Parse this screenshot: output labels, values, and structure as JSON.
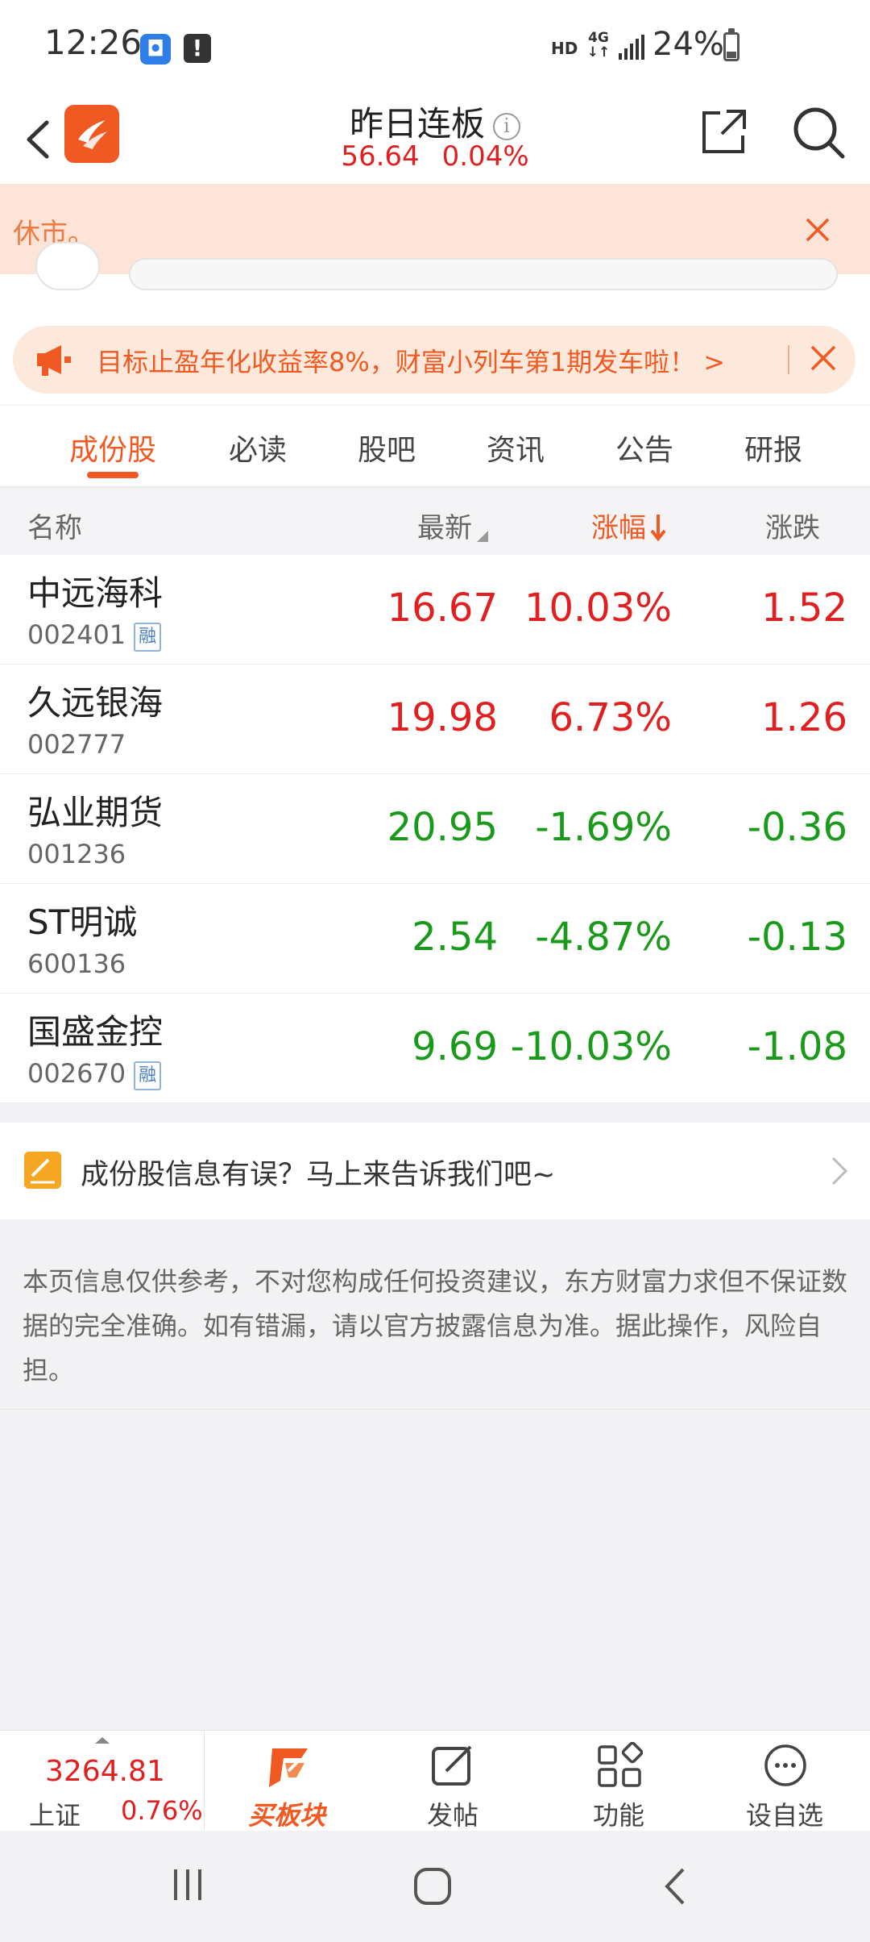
{
  "status_bar": {
    "time": "12:26",
    "hd": "HD",
    "network": "4G",
    "battery": "24%",
    "icons": [
      "app-notification-icon",
      "alert-icon",
      "signal-icon",
      "battery-icon"
    ]
  },
  "header": {
    "title": "昨日连板",
    "price": "56.64",
    "change_pct": "0.04%",
    "info_glyph": "i"
  },
  "closed_banner": {
    "text": "休市。"
  },
  "promo": {
    "text": "目标止盈年化收益率8%，财富小列车第1期发车啦！ >"
  },
  "tabs": [
    {
      "label": "成份股",
      "active": true
    },
    {
      "label": "必读"
    },
    {
      "label": "股吧"
    },
    {
      "label": "资讯"
    },
    {
      "label": "公告"
    },
    {
      "label": "研报"
    }
  ],
  "table": {
    "headers": {
      "name": "名称",
      "latest": "最新",
      "pct": "涨幅",
      "chg": "涨跌"
    },
    "rows": [
      {
        "name": "中远海科",
        "code": "002401",
        "margin": "融",
        "latest": "16.67",
        "pct": "10.03%",
        "chg": "1.52",
        "dir": "up"
      },
      {
        "name": "久远银海",
        "code": "002777",
        "latest": "19.98",
        "pct": "6.73%",
        "chg": "1.26",
        "dir": "up"
      },
      {
        "name": "弘业期货",
        "code": "001236",
        "latest": "20.95",
        "pct": "-1.69%",
        "chg": "-0.36",
        "dir": "down"
      },
      {
        "name": "ST明诚",
        "code": "600136",
        "latest": "2.54",
        "pct": "-4.87%",
        "chg": "-0.13",
        "dir": "down"
      },
      {
        "name": "国盛金控",
        "code": "002670",
        "margin": "融",
        "latest": "9.69",
        "pct": "-10.03%",
        "chg": "-1.08",
        "dir": "down"
      }
    ]
  },
  "feedback": {
    "text": "成份股信息有误？马上来告诉我们吧~"
  },
  "disclaimer": {
    "text": "本页信息仅供参考，不对您构成任何投资建议，东方财富力求但不保证数据的完全准确。如有错漏，请以官方披露信息为准。据此操作，风险自担。"
  },
  "bottom_nav": {
    "index_value": "3264.81",
    "index_name": "上证",
    "index_pct": "0.76%",
    "buy": "买板块",
    "post": "发帖",
    "functions": "功能",
    "watchlist": "设自选"
  },
  "colors": {
    "accent": "#f05a22",
    "up": "#e02020",
    "down": "#1a9a1a"
  }
}
